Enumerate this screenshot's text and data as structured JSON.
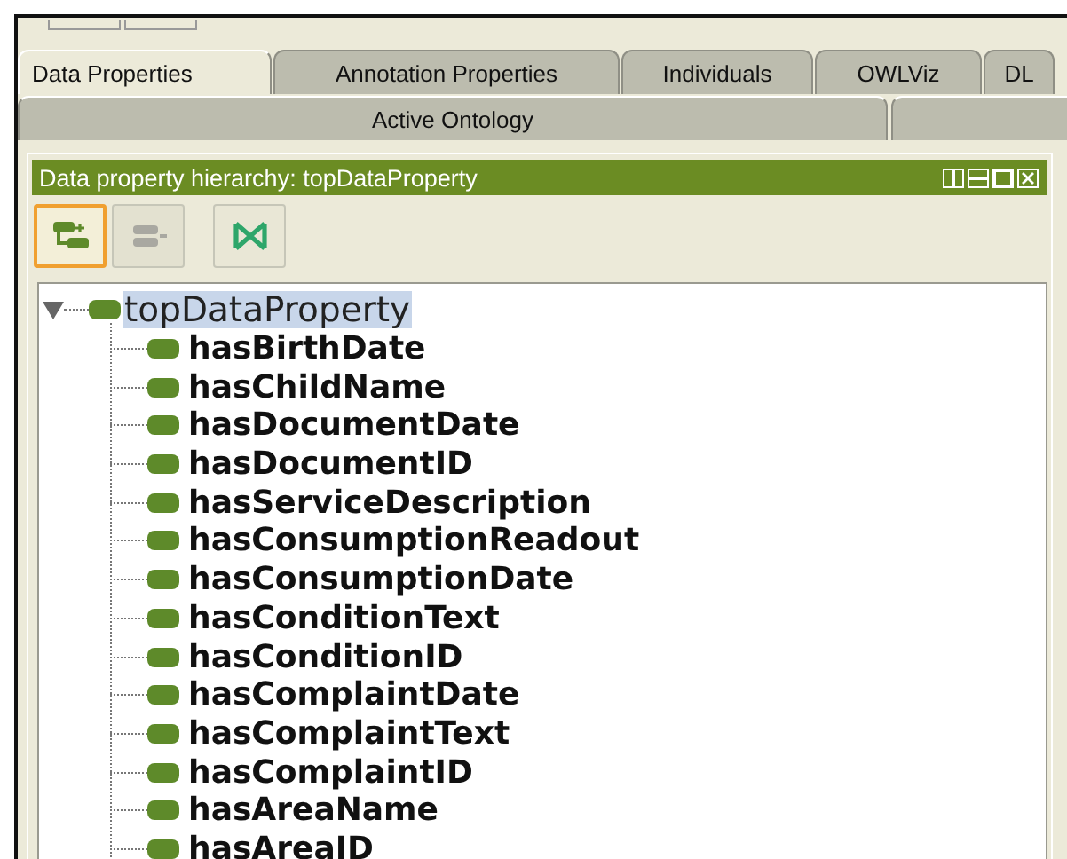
{
  "stub_tabs": [
    {
      "selected": false
    },
    {
      "selected": false
    }
  ],
  "tabs": [
    {
      "label": "Data Properties",
      "selected": true
    },
    {
      "label": "Annotation Properties",
      "selected": false
    },
    {
      "label": "Individuals",
      "selected": false
    },
    {
      "label": "OWLViz",
      "selected": false
    },
    {
      "label": "DL",
      "selected": false
    }
  ],
  "subtabs": [
    {
      "label": "Active Ontology",
      "selected": false
    },
    {
      "selected": false
    }
  ],
  "panel": {
    "title": "Data property hierarchy: topDataProperty",
    "toolbar": [
      {
        "kind": "add-sub",
        "selected": true,
        "disabled": false
      },
      {
        "kind": "add-sibling",
        "selected": false,
        "disabled": true
      },
      {
        "kind": "delete",
        "selected": false,
        "disabled": false
      }
    ],
    "tree": {
      "label": "topDataProperty",
      "selected": true,
      "expanded": true,
      "children": [
        {
          "label": "hasBirthDate",
          "selected": false
        },
        {
          "label": "hasChildName",
          "selected": false
        },
        {
          "label": "hasDocumentDate",
          "selected": false
        },
        {
          "label": "hasDocumentID",
          "selected": false
        },
        {
          "label": "hasServiceDescription",
          "selected": false
        },
        {
          "label": "hasConsumptionReadout",
          "selected": false
        },
        {
          "label": "hasConsumptionDate",
          "selected": false
        },
        {
          "label": "hasConditionText",
          "selected": false
        },
        {
          "label": "hasConditionID",
          "selected": false
        },
        {
          "label": "hasComplaintDate",
          "selected": false
        },
        {
          "label": "hasComplaintText",
          "selected": false
        },
        {
          "label": "hasComplaintID",
          "selected": false
        },
        {
          "label": "hasAreaName",
          "selected": false
        },
        {
          "label": "hasAreaID",
          "selected": false
        }
      ]
    }
  }
}
